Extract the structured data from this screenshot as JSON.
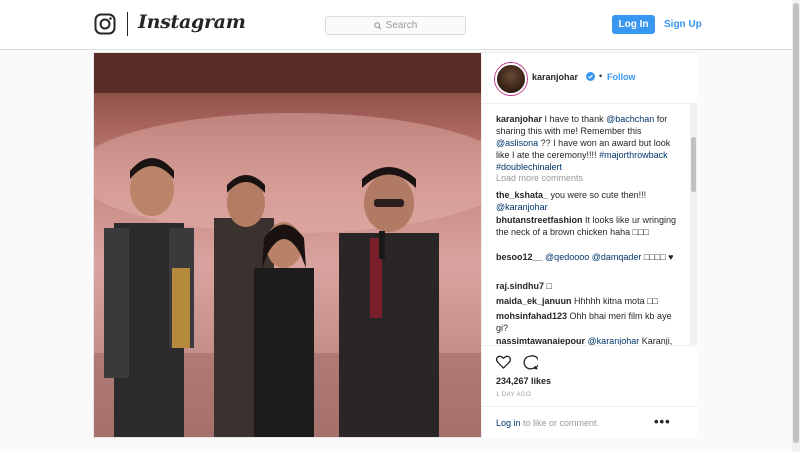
{
  "header": {
    "brand": "Instagram",
    "search_placeholder": "Search",
    "login_label": "Log In",
    "signup_label": "Sign Up"
  },
  "colors": {
    "accent": "#3897f0",
    "link_dark": "#003569",
    "muted": "#999999",
    "text": "#262626"
  },
  "post": {
    "username": "karanjohar",
    "follow_label": "Follow",
    "separator": "•",
    "caption": {
      "user": "karanjohar",
      "text1": " I have to thank ",
      "mention1": "@bachchan",
      "text2": " for sharing this with me! Remember this ",
      "mention2": "@aslisona",
      "text3": " ?? I have won an award but look like I ate the ceremony!!!! ",
      "tag1": "#majorthrowback",
      "tag2": "#doublechinalert"
    },
    "load_more": "Load more comments",
    "comments": [
      {
        "user": "the_kshata_",
        "text": " you were so cute then!!! ",
        "mention": "@karanjohar"
      },
      {
        "user": "bhutanstreetfashion",
        "text": " It looks like ur wringing the neck of a brown chicken haha □□□",
        "mention": ""
      },
      {
        "user": "besoo12__",
        "text": " ",
        "mention": "@qedoooo @damqader",
        "text_after": " □□□□ ♥"
      },
      {
        "user": "raj.sindhu7",
        "text": " □",
        "mention": ""
      },
      {
        "user": "maida_ek_januun",
        "text": " Hhhhh kitna mota □□",
        "mention": ""
      },
      {
        "user": "mohsinfahad123",
        "text": " Ohh bhai meri film kb aye gi?",
        "mention": ""
      },
      {
        "user": "nassimtawanaiepour",
        "text": " ",
        "mention": "@karanjohar",
        "text_after": " Karanji,"
      }
    ],
    "likes": "234,267 likes",
    "time": "1 DAY AGO",
    "login_prompt": {
      "link": "Log in",
      "text": " to like or comment."
    },
    "more_label": "•••"
  },
  "icons": [
    "instagram-camera-icon",
    "search-icon",
    "verified-badge-icon",
    "heart-icon",
    "comment-icon",
    "more-options-icon"
  ]
}
